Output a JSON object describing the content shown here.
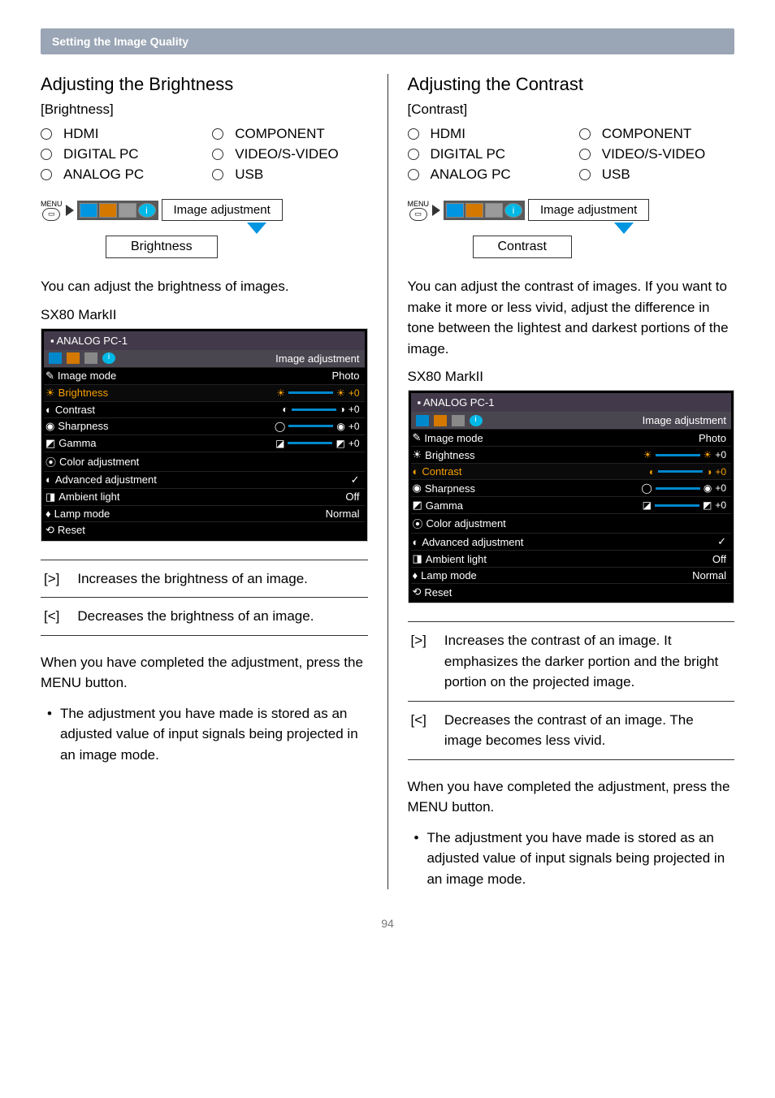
{
  "header": "Setting the Image Quality",
  "page_number": "94",
  "inputs": [
    "HDMI",
    "COMPONENT",
    "DIGITAL PC",
    "VIDEO/S-VIDEO",
    "ANALOG PC",
    "USB"
  ],
  "menu_label": "Image adjustment",
  "menu_btn": "MENU",
  "left": {
    "title": "Adjusting the Brightness",
    "subtitle": "[Brightness]",
    "branch": "Brightness",
    "intro": "You can adjust the brightness of images.",
    "model": "SX80 MarkII",
    "dirs": {
      "up": {
        "key": "[>]",
        "text": "Increases the brightness of an image."
      },
      "down": {
        "key": "[<]",
        "text": "Decreases the brightness of an image."
      }
    },
    "closing1a": "When you have completed the adjustment, press the ",
    "closing1b": "MENU",
    "closing1c": " button.",
    "bullet": "The adjustment you have made is stored as an adjusted value of input signals being projected in an image mode."
  },
  "right": {
    "title": "Adjusting the Contrast",
    "subtitle": "[Contrast]",
    "branch": "Contrast",
    "intro": "You can adjust the contrast of images. If you want to make it more or less vivid, adjust the difference in tone between the lightest and darkest portions of the image.",
    "model": "SX80 MarkII",
    "dirs": {
      "up": {
        "key": "[>]",
        "text": "Increases the contrast of an image. It emphasizes the darker portion and the bright portion on the projected image."
      },
      "down": {
        "key": "[<]",
        "text": "Decreases the contrast of an image. The image becomes less vivid."
      }
    },
    "closing1a": "When you have completed the adjustment, press the ",
    "closing1b": "MENU",
    "closing1c": " button.",
    "bullet": "The adjustment you have made is stored as an adjusted value of input signals being projected in an image mode."
  },
  "osd": {
    "source": "ANALOG PC-1",
    "tab_label": "Image adjustment",
    "rows": {
      "image_mode": {
        "label": "Image mode",
        "value": "Photo"
      },
      "brightness": {
        "label": "Brightness",
        "value": "+0"
      },
      "contrast": {
        "label": "Contrast",
        "value": "+0"
      },
      "sharpness": {
        "label": "Sharpness",
        "value": "+0"
      },
      "gamma": {
        "label": "Gamma",
        "value": "+0"
      },
      "color_adj": {
        "label": "Color adjustment"
      },
      "advanced": {
        "label": "Advanced adjustment",
        "value": "✓"
      },
      "ambient": {
        "label": "Ambient light",
        "value": "Off"
      },
      "lamp": {
        "label": "Lamp mode",
        "value": "Normal"
      },
      "reset": {
        "label": "Reset"
      }
    }
  },
  "chart_data": [
    {
      "type": "table",
      "title": "Image adjustment OSD — Brightness highlighted (SX80 MarkII)",
      "source": "ANALOG PC-1",
      "highlighted_row": "Brightness",
      "rows": [
        {
          "label": "Image mode",
          "value": "Photo"
        },
        {
          "label": "Brightness",
          "value": "+0"
        },
        {
          "label": "Contrast",
          "value": "+0"
        },
        {
          "label": "Sharpness",
          "value": "+0"
        },
        {
          "label": "Gamma",
          "value": "+0"
        },
        {
          "label": "Color adjustment",
          "value": ""
        },
        {
          "label": "Advanced adjustment",
          "value": "✓"
        },
        {
          "label": "Ambient light",
          "value": "Off"
        },
        {
          "label": "Lamp mode",
          "value": "Normal"
        },
        {
          "label": "Reset",
          "value": ""
        }
      ]
    },
    {
      "type": "table",
      "title": "Image adjustment OSD — Contrast highlighted (SX80 MarkII)",
      "source": "ANALOG PC-1",
      "highlighted_row": "Contrast",
      "rows": [
        {
          "label": "Image mode",
          "value": "Photo"
        },
        {
          "label": "Brightness",
          "value": "+0"
        },
        {
          "label": "Contrast",
          "value": "+0"
        },
        {
          "label": "Sharpness",
          "value": "+0"
        },
        {
          "label": "Gamma",
          "value": "+0"
        },
        {
          "label": "Color adjustment",
          "value": ""
        },
        {
          "label": "Advanced adjustment",
          "value": "✓"
        },
        {
          "label": "Ambient light",
          "value": "Off"
        },
        {
          "label": "Lamp mode",
          "value": "Normal"
        },
        {
          "label": "Reset",
          "value": ""
        }
      ]
    }
  ]
}
